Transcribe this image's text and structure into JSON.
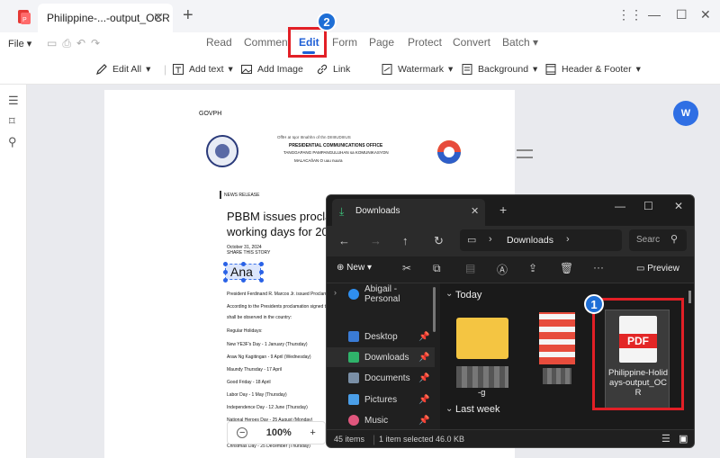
{
  "app": {
    "tab_title": "Philippine-...-output_OCR",
    "new_tab": "+",
    "window_controls": [
      "⋮⋮",
      "—",
      "☐",
      "✕"
    ]
  },
  "menu": {
    "file": "File",
    "items": [
      "Read",
      "Comment",
      "Edit",
      "Form",
      "Page",
      "Protect",
      "Convert",
      "Batch"
    ],
    "active": "Edit"
  },
  "toolbar": {
    "edit_all": "Edit All",
    "add_text": "Add text",
    "add_image": "Add Image",
    "link": "Link",
    "watermark": "Watermark",
    "background": "Background",
    "header_footer": "Header & Footer"
  },
  "document": {
    "govph": "GOVPH",
    "office_line1": "OffIH aI Iqor IIInahhn of thn DIIIIIUDIIIUS",
    "office_line2": "PRESIDENTIAL COMMUNICATIONS OFFICE",
    "office_line3": "TANGGAPANG PAMPANGULUHAN sa KOMUNIKASYON",
    "office_line4": "MALACAñAN O              uuu nuura",
    "news_release": "NEWS RELEASE",
    "headline1": "PBBM issues proclar",
    "headline2": "working days for 202",
    "date": "October 31, 2024",
    "share": "SHARE THIS STORY",
    "selected_text": "Ana",
    "body": [
      "President Ferdinand R. Marcos Jr. issued Proclam",
      "According to the Presidents proclamation signed t",
      "shall be observed in the country:",
      "Regular Holidays:",
      "New YE3F's Day - 1 January (Thursday)",
      "Araw Ng Kagitingan - 9 April (Wednesday)",
      "Maundy Thursday - 17 April",
      "Good Friday - 18 April",
      "Labor Day - 1 May (Thursday)",
      "Independence Day - 12 June (Thursday)",
      "National Heroes Day - 25 August (Monday)",
      "Christmas Day - 25 December (Thursday)"
    ]
  },
  "zoom": {
    "minus": "−",
    "value": "100%",
    "plus": "+"
  },
  "word_button": "W",
  "callouts": {
    "one": "1",
    "two": "2"
  },
  "explorer": {
    "tab_title": "Downloads",
    "address": "Downloads",
    "search_placeholder": "Searc",
    "new_label": "New",
    "preview_label": "Preview",
    "nav": [
      {
        "label": "Abigail - Personal",
        "color": "#2f8ff0"
      },
      {
        "label": "Desktop",
        "color": "#3a7bd5"
      },
      {
        "label": "Downloads",
        "color": "#2fb36a"
      },
      {
        "label": "Documents",
        "color": "#7a8fa6"
      },
      {
        "label": "Pictures",
        "color": "#4a9ee8"
      },
      {
        "label": "Music",
        "color": "#e0567d"
      }
    ],
    "group_today": "Today",
    "group_last_week": "Last week",
    "pdf_badge": "PDF",
    "pdf_name": "Philippine-Holidays-output_OCR",
    "folder_name_tail": "-g",
    "status_count": "45 items",
    "status_selected": "1 item selected",
    "status_size": "46.0 KB"
  }
}
